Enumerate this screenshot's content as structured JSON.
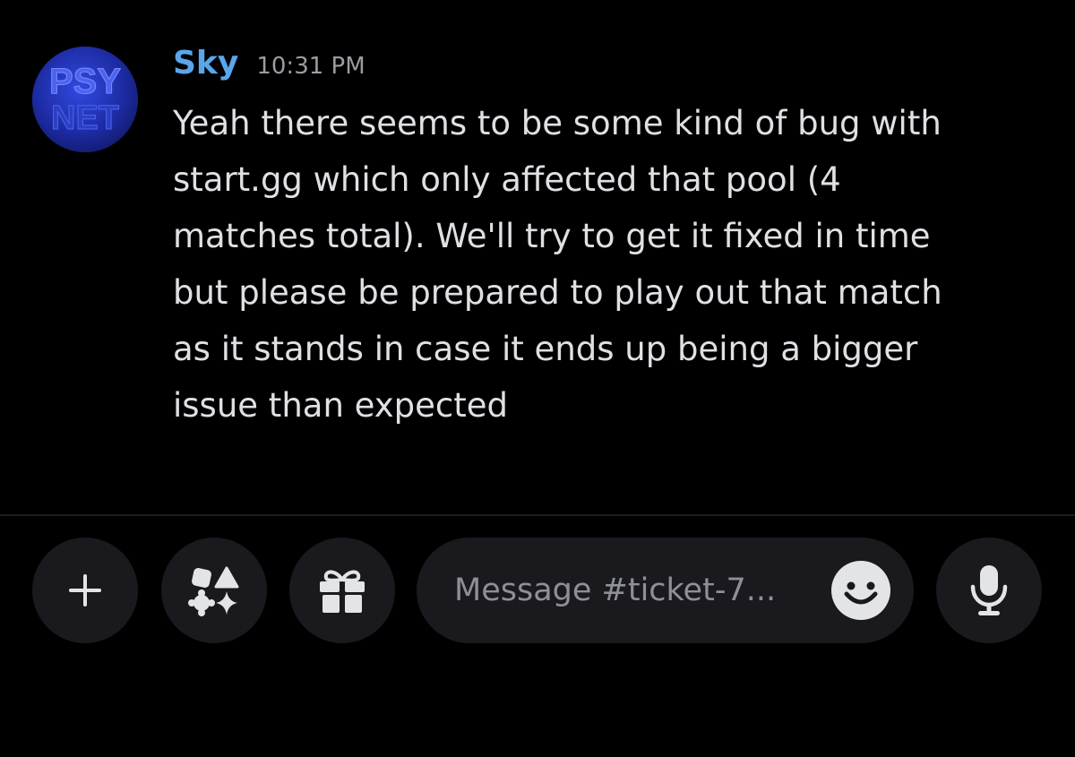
{
  "message": {
    "author": "Sky",
    "timestamp": "10:31 PM",
    "avatar_text": [
      "PSY",
      "NET"
    ],
    "lines": [
      "Yeah there seems to be some kind of bug with",
      "start.gg which only affected that pool (4",
      "matches total). We'll try to get it fixed in time",
      "but please be prepared to play out that match",
      "as it stands in case it ends up being a bigger",
      "issue than expected"
    ]
  },
  "composer": {
    "placeholder": "Message #ticket-7...",
    "buttons": {
      "plus": "plus-icon",
      "apps": "apps-icon",
      "gift": "gift-icon",
      "emoji": "emoji-icon",
      "mic": "microphone-icon"
    }
  },
  "colors": {
    "background": "#000000",
    "username": "#5aa6ea",
    "message_text": "#dfe0e4",
    "timestamp": "#9a9ca3",
    "button_bg": "#1a1a1e",
    "avatar_blue": "#1c2a9c"
  }
}
